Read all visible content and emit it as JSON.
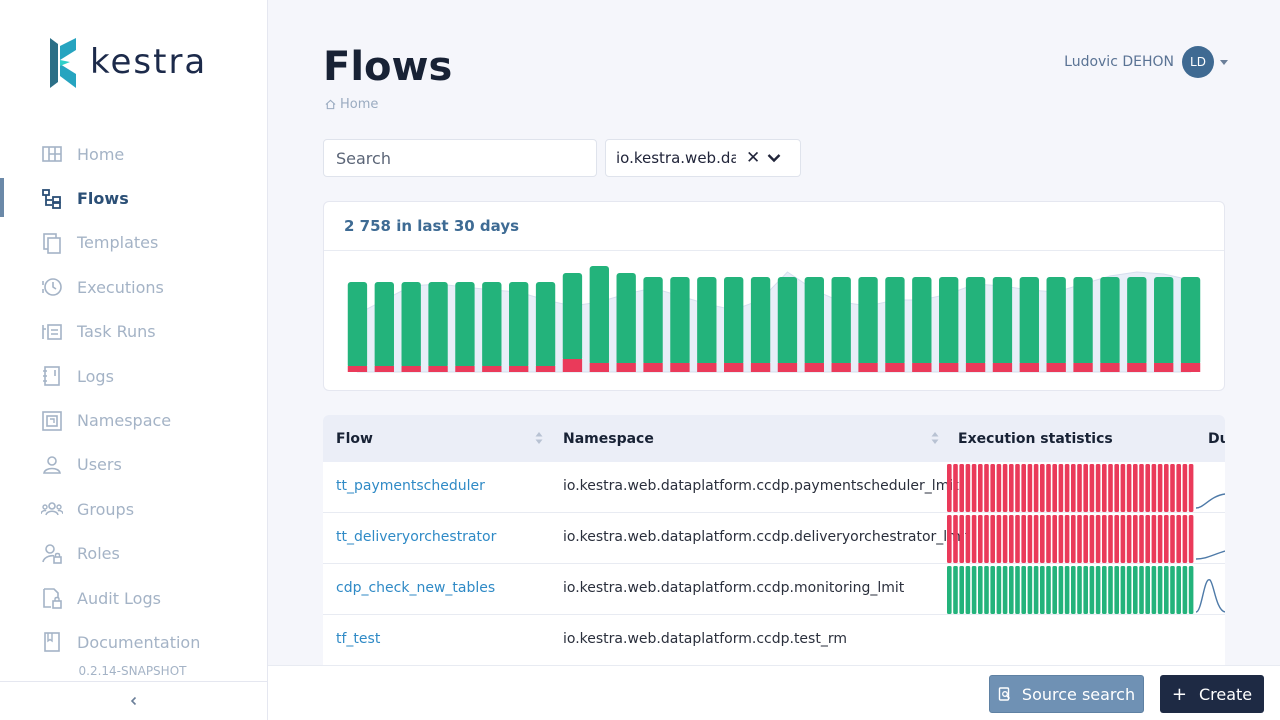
{
  "app": {
    "logo_text": "kestra",
    "version": "0.2.14-SNAPSHOT"
  },
  "sidebar": {
    "items": [
      {
        "label": "Home",
        "icon": "dashboard-icon",
        "active": false
      },
      {
        "label": "Flows",
        "icon": "flows-tree-icon",
        "active": true
      },
      {
        "label": "Templates",
        "icon": "copy-icon",
        "active": false
      },
      {
        "label": "Executions",
        "icon": "history-icon",
        "active": false
      },
      {
        "label": "Task Runs",
        "icon": "task-list-icon",
        "active": false
      },
      {
        "label": "Logs",
        "icon": "notebook-icon",
        "active": false
      },
      {
        "label": "Namespace",
        "icon": "namespace-icon",
        "active": false
      },
      {
        "label": "Users",
        "icon": "user-icon",
        "active": false
      },
      {
        "label": "Groups",
        "icon": "group-icon",
        "active": false
      },
      {
        "label": "Roles",
        "icon": "user-lock-icon",
        "active": false
      },
      {
        "label": "Audit Logs",
        "icon": "file-lock-icon",
        "active": false
      },
      {
        "label": "Documentation",
        "icon": "book-icon",
        "active": false
      }
    ],
    "collapse_icon": "chevron-left-icon"
  },
  "header": {
    "title": "Flows",
    "breadcrumb": "Home",
    "user_name": "Ludovic DEHON",
    "user_initials": "LD"
  },
  "filters": {
    "search_placeholder": "Search",
    "namespace_value": "io.kestra.web.dataplatform"
  },
  "summary": {
    "label": "2 758 in last 30 days"
  },
  "chart_data": {
    "type": "bar",
    "title": "2 758 in last 30 days",
    "series": [
      {
        "name": "success",
        "color": "#23b37b",
        "values": [
          84,
          84,
          84,
          84,
          84,
          84,
          84,
          84,
          86,
          97,
          90,
          86,
          86,
          86,
          86,
          86,
          86,
          86,
          86,
          86,
          86,
          86,
          86,
          86,
          86,
          86,
          86,
          86,
          86,
          86,
          86,
          86
        ]
      },
      {
        "name": "failed",
        "color": "#ea3a5a",
        "values": [
          6,
          6,
          6,
          6,
          6,
          6,
          6,
          6,
          13,
          9,
          9,
          9,
          9,
          9,
          9,
          9,
          9,
          9,
          9,
          9,
          9,
          9,
          9,
          9,
          9,
          9,
          9,
          9,
          9,
          9,
          9,
          9
        ]
      }
    ],
    "background_area": [
      58,
      72,
      86,
      88,
      85,
      82,
      80,
      72,
      66,
      70,
      78,
      84,
      76,
      68,
      62,
      72,
      100,
      82,
      70,
      66,
      72,
      72,
      78,
      88,
      86,
      82,
      80,
      88,
      96,
      100,
      98,
      92
    ]
  },
  "table": {
    "columns": [
      "Flow",
      "Namespace",
      "Execution statistics",
      "Du"
    ],
    "rows": [
      {
        "flow": "tt_paymentscheduler",
        "namespace": "io.kestra.web.dataplatform.ccdp.paymentscheduler_lmit",
        "stats": "failed"
      },
      {
        "flow": "tt_deliveryorchestrator",
        "namespace": "io.kestra.web.dataplatform.ccdp.deliveryorchestrator_lmit",
        "stats": "failed"
      },
      {
        "flow": "cdp_check_new_tables",
        "namespace": "io.kestra.web.dataplatform.ccdp.monitoring_lmit",
        "stats": "success"
      },
      {
        "flow": "tf_test",
        "namespace": "io.kestra.web.dataplatform.ccdp.test_rm",
        "stats": "none"
      }
    ],
    "colors": {
      "failed": "#ea3a5a",
      "success": "#23b37b"
    }
  },
  "footer": {
    "source_search_label": "Source search",
    "create_label": "Create"
  }
}
